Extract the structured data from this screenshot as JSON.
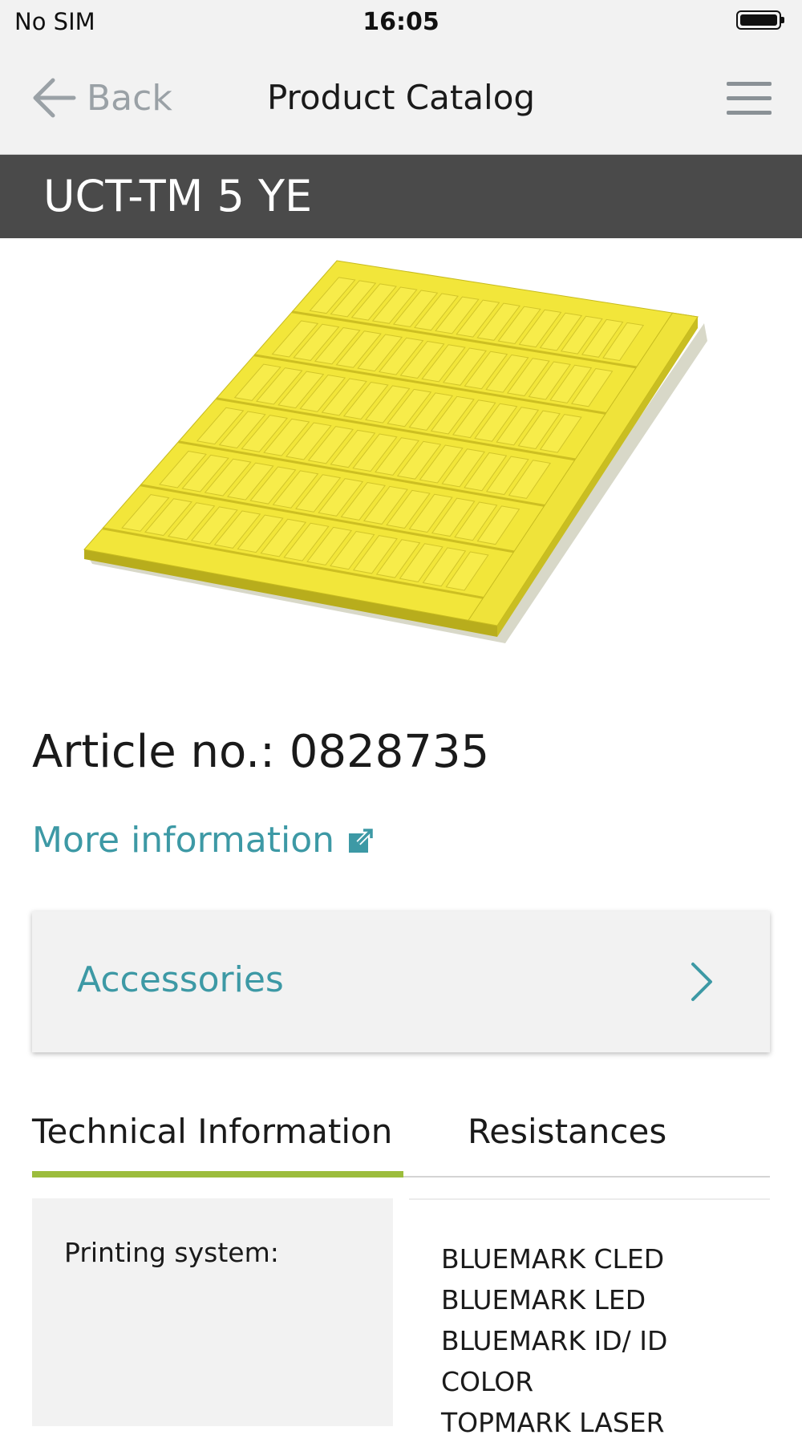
{
  "status_bar": {
    "carrier": "No SIM",
    "time": "16:05",
    "battery_level": 1.0
  },
  "nav": {
    "back_label": "Back",
    "title": "Product Catalog"
  },
  "product": {
    "name": "UCT-TM 5 YE",
    "article_no": "Article no.: 0828735",
    "image_color": "#f2e63a"
  },
  "links": {
    "more_info": "More information"
  },
  "accessories": {
    "label": "Accessories"
  },
  "tabs": [
    {
      "label": "Technical Information",
      "active": true
    },
    {
      "label": "Resistances",
      "active": false
    }
  ],
  "specs": [
    {
      "label": "Printing system:",
      "values": [
        "BLUEMARK CLED",
        "BLUEMARK LED",
        "BLUEMARK ID/ ID",
        "COLOR",
        "TOPMARK LASER"
      ]
    }
  ],
  "colors": {
    "accent_teal": "#3d99a5",
    "tab_active_underline": "#9cbd3c",
    "header_dark": "#4a4a4a"
  }
}
